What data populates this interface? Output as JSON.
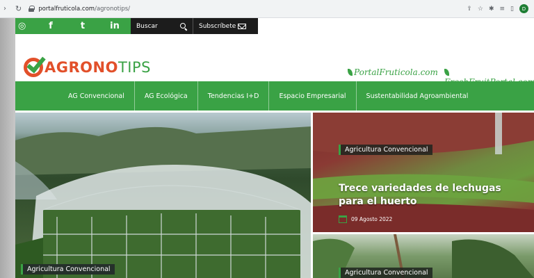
{
  "browser": {
    "url_domain": "portalfruticola.com",
    "url_path": "/agronotips/",
    "profile_initial": "D"
  },
  "topbar": {
    "social": [
      "instagram-icon",
      "facebook-icon",
      "twitter-icon",
      "linkedin-icon"
    ],
    "social_glyphs": [
      "◎",
      "f",
      "t",
      "in"
    ],
    "search_label": "Buscar",
    "subscribe_label": "Subscríbete"
  },
  "logo": {
    "part1": "AGRONO",
    "part2": "TIPS"
  },
  "partners": [
    "PortalFruticola.com",
    "FreshFruitPortal.com"
  ],
  "menu": [
    "AG Convencional",
    "AG Ecológica",
    "Tendencias I+D",
    "Espacio Empresarial",
    "Sustentabilidad Agroambiental"
  ],
  "articles": {
    "left": {
      "tag": "Agricultura Convencional"
    },
    "right_top": {
      "tag": "Agricultura Convencional",
      "title": "Trece variedades de lechugas para el huerto",
      "date": "09 Agosto 2022"
    },
    "right_bottom": {
      "tag": "Agricultura Convencional"
    }
  },
  "colors": {
    "green": "#3aa245",
    "orange": "#e2502a",
    "dark": "#1c1c1c"
  }
}
